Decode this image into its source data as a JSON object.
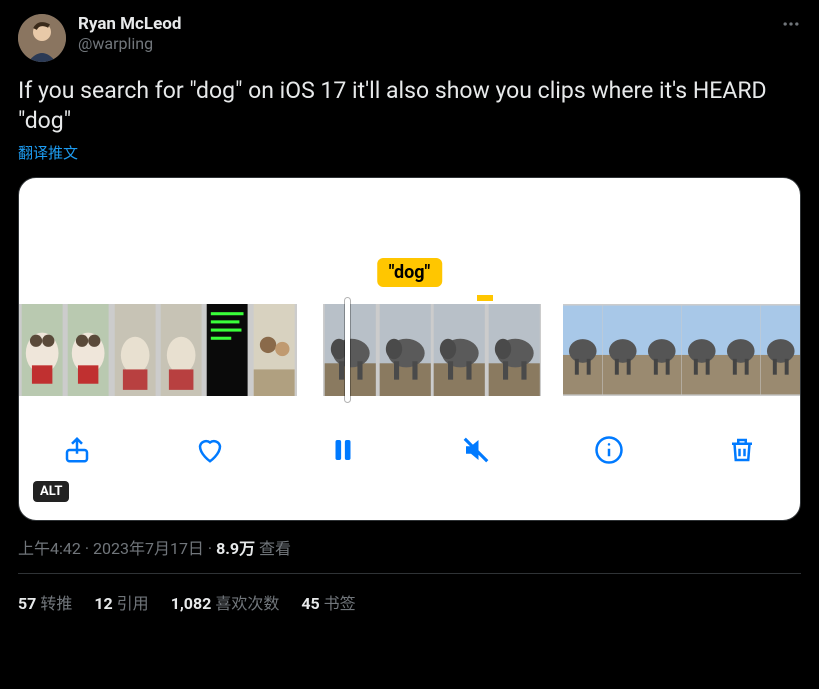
{
  "user": {
    "display_name": "Ryan McLeod",
    "handle": "@warpling"
  },
  "tweet": {
    "text": "If you search for \"dog\" on iOS 17 it'll also show you clips where it's HEARD \"dog\"",
    "translate_label": "翻译推文"
  },
  "media": {
    "tooltip": "\"dog\"",
    "alt_label": "ALT"
  },
  "meta": {
    "time": "上午4:42",
    "date": "2023年7月17日",
    "views_num": "8.9万",
    "views_label": "查看"
  },
  "stats": {
    "retweets_num": "57",
    "retweets_label": "转推",
    "quotes_num": "12",
    "quotes_label": "引用",
    "likes_num": "1,082",
    "likes_label": "喜欢次数",
    "bookmarks_num": "45",
    "bookmarks_label": "书签"
  }
}
